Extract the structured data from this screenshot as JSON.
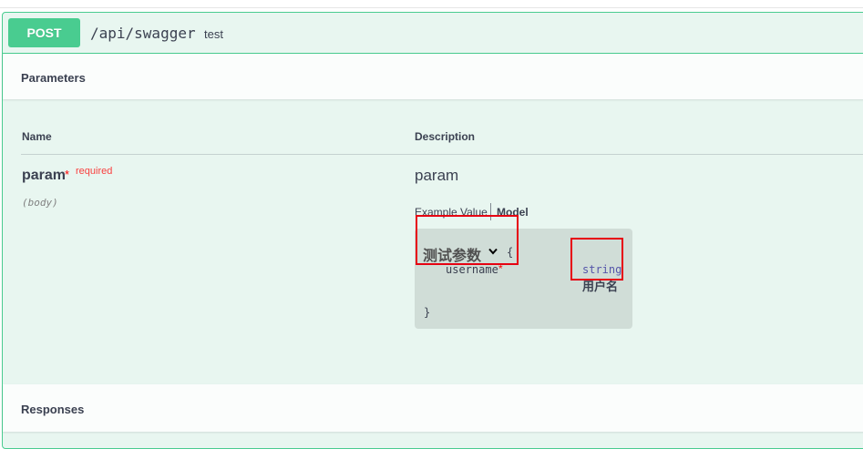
{
  "operation": {
    "method": "POST",
    "path": "/api/swagger",
    "summary": "test"
  },
  "sections": {
    "parameters_title": "Parameters",
    "responses_title": "Responses"
  },
  "table": {
    "col_name": "Name",
    "col_description": "Description"
  },
  "parameter": {
    "name": "param",
    "required_star": "*",
    "required_label": "required",
    "location": "(body)",
    "description": "param"
  },
  "tabs": {
    "example": "Example Value",
    "model": "Model",
    "active": "Model"
  },
  "model": {
    "title": "测试参数",
    "brace_open": "{",
    "brace_close": "}",
    "properties": [
      {
        "name": "username",
        "required_star": "*",
        "type": "string",
        "description": "用户名"
      }
    ]
  },
  "colors": {
    "post_green": "#49cc90",
    "post_bg": "#e8f6f0",
    "required_red": "#ff0000",
    "highlight_red": "#e60012"
  },
  "icons": {
    "model_toggle": "chevron-down-icon"
  }
}
